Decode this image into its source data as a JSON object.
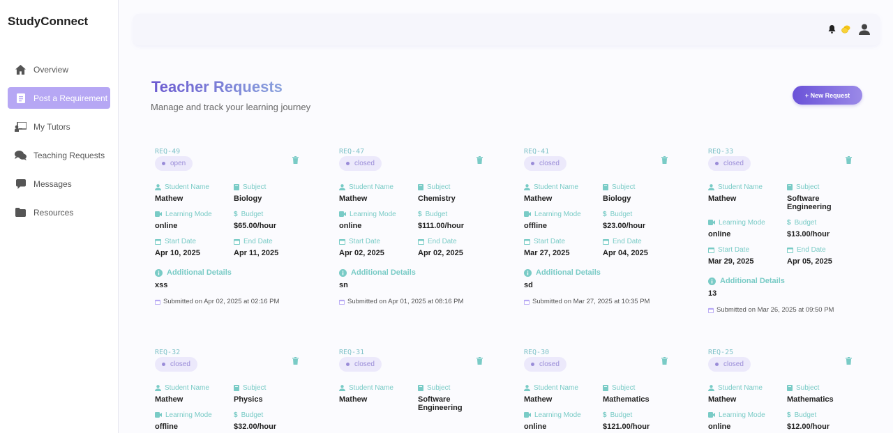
{
  "app": {
    "brand": "StudyConnect"
  },
  "sidebar": {
    "items": [
      {
        "label": "Overview",
        "icon": "home-icon",
        "active": false
      },
      {
        "label": "Post a Requirement",
        "icon": "clipboard-icon",
        "active": true
      },
      {
        "label": "My Tutors",
        "icon": "chalkboard-teacher-icon",
        "active": false
      },
      {
        "label": "Teaching Requests",
        "icon": "comments-icon",
        "active": false
      },
      {
        "label": "Messages",
        "icon": "message-icon",
        "active": false
      },
      {
        "label": "Resources",
        "icon": "folder-icon",
        "active": false
      }
    ]
  },
  "header": {
    "icons": [
      "bell-icon",
      "coins-icon",
      "user-icon"
    ]
  },
  "page": {
    "title": "Teacher Requests",
    "subtitle": "Manage and track your learning journey",
    "new_button": "+ New Request"
  },
  "labels": {
    "student_name": "Student Name",
    "subject": "Subject",
    "learning_mode": "Learning Mode",
    "budget": "Budget",
    "start_date": "Start Date",
    "end_date": "End Date",
    "additional_details": "Additional Details"
  },
  "colors": {
    "accent": "#7a6ad6",
    "label": "#79cbc6",
    "active_nav": "#b6a7f4"
  },
  "requests": [
    {
      "id": "REQ-49",
      "status": "open",
      "student": "Mathew",
      "subject": "Biology",
      "mode": "online",
      "budget": "$65.00/hour",
      "start": "Apr 10, 2025",
      "end": "Apr 11, 2025",
      "details": "xss",
      "submitted": "Submitted on Apr 02, 2025 at 02:16 PM"
    },
    {
      "id": "REQ-47",
      "status": "closed",
      "student": "Mathew",
      "subject": "Chemistry",
      "mode": "online",
      "budget": "$111.00/hour",
      "start": "Apr 02, 2025",
      "end": "Apr 02, 2025",
      "details": "sn",
      "submitted": "Submitted on Apr 01, 2025 at 08:16 PM"
    },
    {
      "id": "REQ-41",
      "status": "closed",
      "student": "Mathew",
      "subject": "Biology",
      "mode": "offline",
      "budget": "$23.00/hour",
      "start": "Mar 27, 2025",
      "end": "Apr 04, 2025",
      "details": "sd",
      "submitted": "Submitted on Mar 27, 2025 at 10:35 PM"
    },
    {
      "id": "REQ-33",
      "status": "closed",
      "student": "Mathew",
      "subject": "Software Engineering",
      "mode": "online",
      "budget": "$13.00/hour",
      "start": "Mar 29, 2025",
      "end": "Apr 05, 2025",
      "details": "13",
      "submitted": "Submitted on Mar 26, 2025 at 09:50 PM"
    },
    {
      "id": "REQ-32",
      "status": "closed",
      "student": "Mathew",
      "subject": "Physics",
      "mode": "offline",
      "budget": "$32.00/hour"
    },
    {
      "id": "REQ-31",
      "status": "closed",
      "student": "Mathew",
      "subject": "Software Engineering"
    },
    {
      "id": "REQ-30",
      "status": "closed",
      "student": "Mathew",
      "subject": "Mathematics",
      "mode": "online",
      "budget": "$121.00/hour"
    },
    {
      "id": "REQ-25",
      "status": "closed",
      "student": "Mathew",
      "subject": "Mathematics",
      "mode": "online",
      "budget": "$12.00/hour"
    }
  ]
}
